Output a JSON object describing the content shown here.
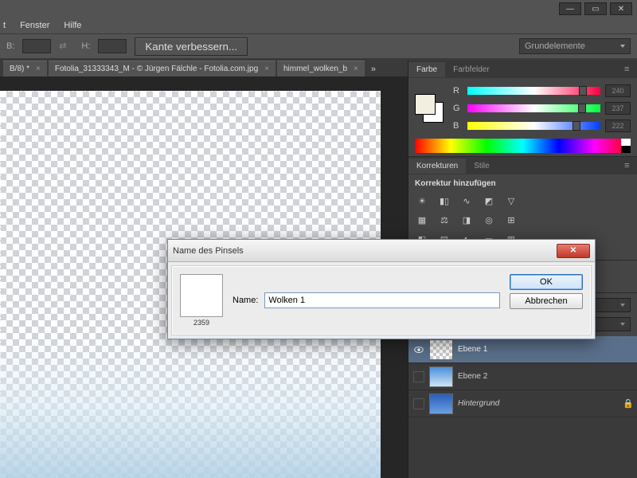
{
  "menubar": {
    "items": [
      "t",
      "Fenster",
      "Hilfe"
    ]
  },
  "optionbar": {
    "b_label": "B:",
    "h_label": "H:",
    "kante_label": "Kante verbessern...",
    "workspace": "Grundelemente"
  },
  "tabs": [
    {
      "label": "B/8) *"
    },
    {
      "label": "Fotolia_31333343_M - © Jürgen Fälchle - Fotolia.com.jpg"
    },
    {
      "label": "himmel_wolken_b"
    }
  ],
  "color_panel": {
    "tabs": [
      "Farbe",
      "Farbfelder"
    ],
    "r": {
      "label": "R",
      "value": "240",
      "thumb": 84
    },
    "g": {
      "label": "G",
      "value": "237",
      "thumb": 83
    },
    "b": {
      "label": "B",
      "value": "222",
      "thumb": 79
    }
  },
  "adjust_panel": {
    "tabs": [
      "Korrekturen",
      "Stile"
    ],
    "title": "Korrektur hinzufügen"
  },
  "layers": {
    "opacity_label": "%",
    "fill_label": "%",
    "items": [
      {
        "name": "Ebene 1",
        "visible": true,
        "thumb": "check",
        "active": true,
        "italic": false,
        "locked": false
      },
      {
        "name": "Ebene 2",
        "visible": false,
        "thumb": "sky",
        "active": false,
        "italic": false,
        "locked": false
      },
      {
        "name": "Hintergrund",
        "visible": false,
        "thumb": "clouds",
        "active": false,
        "italic": true,
        "locked": true
      }
    ]
  },
  "dialog": {
    "title": "Name des Pinsels",
    "thumb_size": "2359",
    "name_label": "Name:",
    "name_value": "Wolken 1",
    "ok": "OK",
    "cancel": "Abbrechen"
  }
}
